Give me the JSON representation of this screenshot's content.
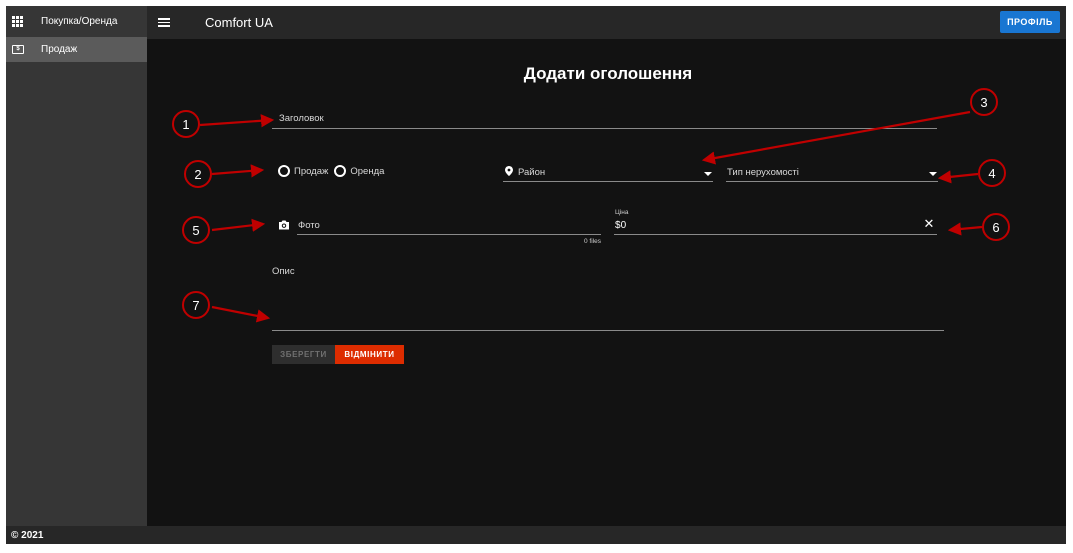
{
  "sidebar": {
    "header_label": "Покупка/Оренда",
    "header_icon": "apps-grid-icon",
    "items": [
      {
        "label": "Продаж",
        "icon": "cash-icon",
        "active": true
      }
    ]
  },
  "topbar": {
    "menu_icon": "hamburger-menu-icon",
    "title": "Comfort UA",
    "profile_label": "ПРОФІЛЬ",
    "profile_color": "#1976d2"
  },
  "form": {
    "page_title": "Додати оголошення",
    "title_placeholder": "Заголовок",
    "deal_type_options": [
      {
        "label": "Продаж",
        "selected": false
      },
      {
        "label": "Оренда",
        "selected": false
      }
    ],
    "district_placeholder": "Район",
    "property_type_placeholder": "Тип нерухомості",
    "photo_placeholder": "Фото",
    "photo_files_count": "0 files",
    "price_label": "Ціна",
    "price_prefix": "$",
    "price_value": "0",
    "description_label": "Опис",
    "save_label": "ЗБЕРЕГТИ",
    "cancel_label": "ВІДМІНИТИ",
    "cancel_color": "#dd2c00"
  },
  "footer": {
    "text": "© 2021"
  },
  "annotations": {
    "color": "#c00000",
    "badges": [
      "1",
      "2",
      "3",
      "4",
      "5",
      "6",
      "7"
    ]
  }
}
